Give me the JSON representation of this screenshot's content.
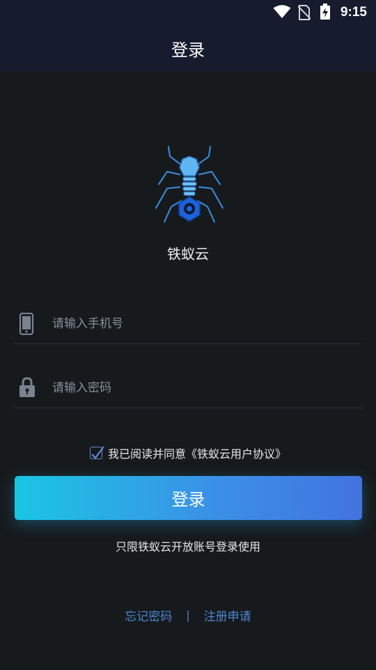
{
  "status_bar": {
    "time": "9:15",
    "icons": [
      "wifi-icon",
      "no-sim-icon",
      "battery-charging-icon"
    ]
  },
  "header": {
    "title": "登录"
  },
  "app": {
    "name": "铁蚁云",
    "logo_icon": "ant-logo"
  },
  "form": {
    "phone": {
      "icon": "phone-icon",
      "placeholder": "请输入手机号",
      "value": ""
    },
    "password": {
      "icon": "lock-icon",
      "placeholder": "请输入密码",
      "value": ""
    },
    "agreement": {
      "checked": true,
      "text": "我已阅读并同意《铁蚁云用户协议》"
    },
    "submit_label": "登录"
  },
  "notice": "只限铁蚁云开放账号登录使用",
  "footer_links": {
    "forgot_password": "忘记密码",
    "separator": "|",
    "register": "注册申请"
  },
  "colors": {
    "background": "#171a1c",
    "header_background": "#161c2e",
    "accent_start": "#1ac6e3",
    "accent_end": "#4273e0",
    "link": "#4a86d4"
  }
}
